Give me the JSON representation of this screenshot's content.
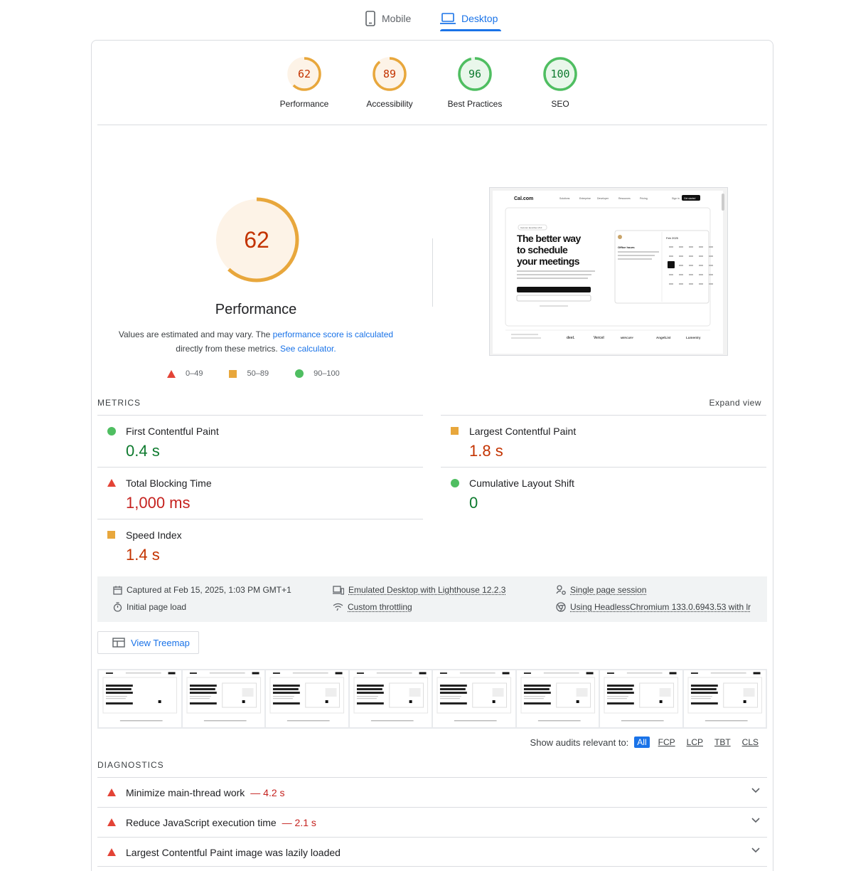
{
  "device_tabs": [
    {
      "label": "Mobile",
      "icon": "phone-icon",
      "active": false
    },
    {
      "label": "Desktop",
      "icon": "laptop-icon",
      "active": true
    }
  ],
  "gauges": [
    {
      "score": "62",
      "label": "Performance",
      "value": 0.62,
      "color": "#e8a73c"
    },
    {
      "score": "89",
      "label": "Accessibility",
      "value": 0.89,
      "color": "#e8a73c"
    },
    {
      "score": "96",
      "label": "Best Practices",
      "value": 0.96,
      "color": "#4fbe61"
    },
    {
      "score": "100",
      "label": "SEO",
      "value": 1.0,
      "color": "#4fbe61"
    }
  ],
  "performance": {
    "score": "62",
    "value": 0.62,
    "title": "Performance",
    "desc_prefix": "Values are estimated and may vary. The ",
    "desc_link": "performance score is calculated",
    "desc_middle": " directly from these metrics. ",
    "calc_link": "See calculator.",
    "legend": [
      "0–49",
      "50–89",
      "90–100"
    ]
  },
  "screenshot": {
    "logo": "Cal.com",
    "nav": [
      "Solutions",
      "Enterprise",
      "Developer",
      "Resources",
      "Pricing",
      "Sign in",
      "Get started"
    ],
    "headline": [
      "The better way",
      "to schedule",
      "your meetings"
    ],
    "badge": "Cal.com launches v5.0",
    "card_title": "Office hours",
    "calendar_month": "Feb 2025",
    "logos": [
      "deel.",
      "Vercel",
      "MERCURY",
      "AngelList",
      "Lumentry"
    ]
  },
  "metrics": {
    "title": "METRICS",
    "expand": "Expand view",
    "items": [
      {
        "name": "First Contentful Paint",
        "value": "0.4 s",
        "status": "good"
      },
      {
        "name": "Largest Contentful Paint",
        "value": "1.8 s",
        "status": "average"
      },
      {
        "name": "Total Blocking Time",
        "value": "1,000 ms",
        "status": "poor"
      },
      {
        "name": "Cumulative Layout Shift",
        "value": "0",
        "status": "good"
      },
      {
        "name": "Speed Index",
        "value": "1.4 s",
        "status": "average"
      }
    ]
  },
  "runinfo": {
    "captured": "Captured at Feb 15, 2025, 1:03 PM GMT+1",
    "load": "Initial page load",
    "emulated": "Emulated Desktop with Lighthouse 12.2.3",
    "throttling": "Custom throttling",
    "session": "Single page session",
    "browser": "Using HeadlessChromium 133.0.6943.53 with lr"
  },
  "treemap_label": "View Treemap",
  "filter": {
    "label": "Show audits relevant to:",
    "chips": [
      "All",
      "FCP",
      "LCP",
      "TBT",
      "CLS"
    ]
  },
  "diagnostics": {
    "title": "DIAGNOSTICS",
    "items": [
      {
        "name": "Minimize main-thread work",
        "value": "— 4.2 s"
      },
      {
        "name": "Reduce JavaScript execution time",
        "value": "— 2.1 s"
      },
      {
        "name": "Largest Contentful Paint image was lazily loaded",
        "value": ""
      }
    ]
  },
  "colors": {
    "accent": "#1a73e8",
    "good": "#0d7a2e",
    "average_text": "#c33300",
    "poor": "#c5221f",
    "orange": "#e8a73c",
    "green": "#4fbe61",
    "red": "#e34336"
  }
}
